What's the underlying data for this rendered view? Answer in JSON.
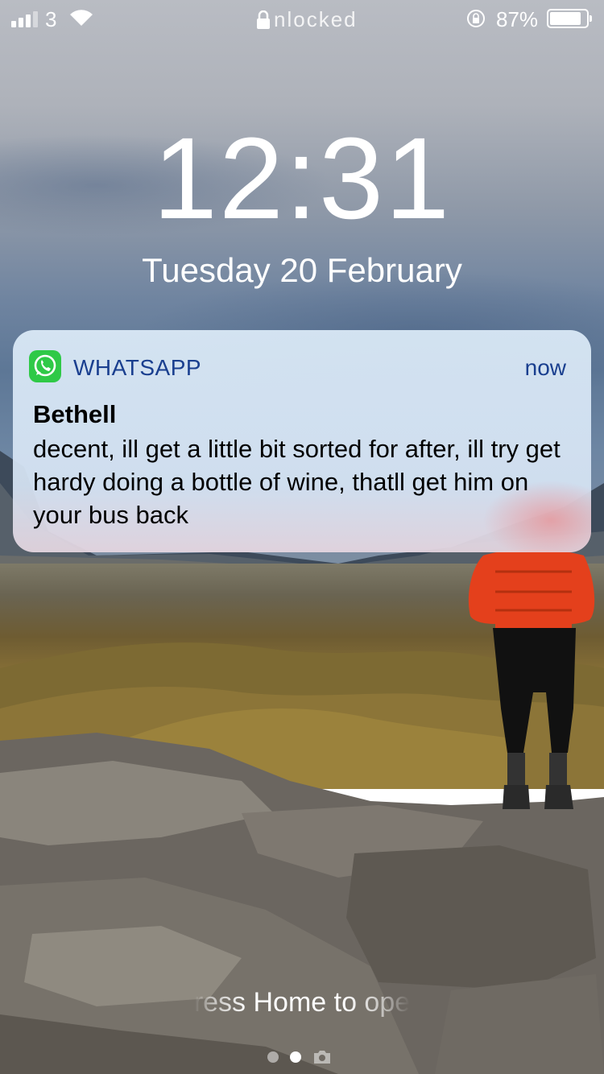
{
  "status_bar": {
    "carrier": "3",
    "lock_text": "nlocked",
    "battery_percent": "87%",
    "battery_level": 0.87
  },
  "lock_screen": {
    "time": "12:31",
    "date": "Tuesday 20 February"
  },
  "notification": {
    "app_name": "WHATSAPP",
    "time": "now",
    "sender": "Bethell",
    "message": "decent, ill get a little bit sorted for after, ill try get hardy doing a bottle of wine, thatll get him on your bus back",
    "app_color": "#2fc947"
  },
  "home_hint": "ress Home to ope",
  "page_indicator": {
    "pages": 3,
    "active_index": 1,
    "last_icon": "camera-icon"
  }
}
